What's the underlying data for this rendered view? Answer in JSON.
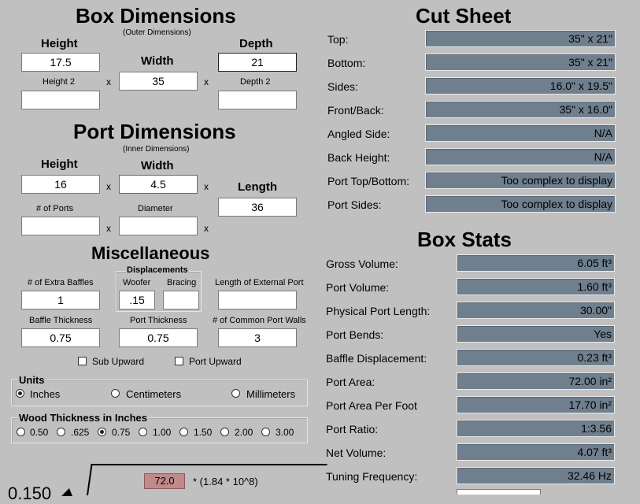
{
  "box_dimensions": {
    "title": "Box Dimensions",
    "subtitle": "(Outer Dimensions)",
    "height_label": "Height",
    "width_label": "Width",
    "depth_label": "Depth",
    "height2_label": "Height 2",
    "depth2_label": "Depth 2",
    "height_value": "17.5",
    "width_value": "35",
    "depth_value": "21",
    "height2_value": "",
    "depth2_value": "",
    "x": "x"
  },
  "port_dimensions": {
    "title": "Port Dimensions",
    "subtitle": "(Inner Dimensions)",
    "height_label": "Height",
    "width_label": "Width",
    "length_label": "Length",
    "ports_label": "# of Ports",
    "diameter_label": "Diameter",
    "height_value": "16",
    "width_value": "4.5",
    "length_value": "36",
    "ports_value": "",
    "diameter_value": "",
    "x": "x"
  },
  "misc": {
    "title": "Miscellaneous",
    "displacements_label": "Displacements",
    "extra_baffles_label": "# of Extra Baffles",
    "woofer_label": "Woofer",
    "bracing_label": "Bracing",
    "ext_port_label": "Length of External Port",
    "baffle_thickness_label": "Baffle Thickness",
    "port_thickness_label": "Port Thickness",
    "common_walls_label": "# of Common Port Walls",
    "extra_baffles_value": "1",
    "woofer_value": ".15",
    "bracing_value": "",
    "ext_port_value": "",
    "baffle_thickness_value": "0.75",
    "port_thickness_value": "0.75",
    "common_walls_value": "3",
    "sub_upward_label": "Sub Upward",
    "port_upward_label": "Port Upward"
  },
  "units": {
    "title": "Units",
    "options": [
      "Inches",
      "Centimeters",
      "Millimeters"
    ],
    "selected": "Inches"
  },
  "wood": {
    "title": "Wood Thickness in Inches",
    "options": [
      "0.50",
      ".625",
      "0.75",
      "1.00",
      "1.50",
      "2.00",
      "3.00"
    ],
    "selected": "0.75"
  },
  "bottom": {
    "value_box": "72.0",
    "formula": "* (1.84 * 10^8)",
    "partial_label": "0.150"
  },
  "cut_sheet": {
    "title": "Cut Sheet",
    "rows": [
      {
        "label": "Top:",
        "value": "35\" x 21\""
      },
      {
        "label": "Bottom:",
        "value": "35\" x 21\""
      },
      {
        "label": "Sides:",
        "value": "16.0\" x 19.5\""
      },
      {
        "label": "Front/Back:",
        "value": "35\" x 16.0\""
      },
      {
        "label": "Angled Side:",
        "value": "N/A"
      },
      {
        "label": "Back Height:",
        "value": "N/A"
      },
      {
        "label": "Port Top/Bottom:",
        "value": "Too complex to display"
      },
      {
        "label": "Port Sides:",
        "value": "Too complex to display"
      }
    ]
  },
  "box_stats": {
    "title": "Box Stats",
    "rows": [
      {
        "label": "Gross Volume:",
        "value": "6.05 ft³"
      },
      {
        "label": "Port Volume:",
        "value": "1.60 ft³"
      },
      {
        "label": "Physical Port Length:",
        "value": "30.00\""
      },
      {
        "label": "Port Bends:",
        "value": "Yes"
      },
      {
        "label": "Baffle Displacement:",
        "value": "0.23 ft³"
      },
      {
        "label": "Port Area:",
        "value": "72.00 in²"
      },
      {
        "label": "Port Area Per Foot",
        "value": "17.70 in²"
      },
      {
        "label": "Port Ratio:",
        "value": "1:3.56"
      },
      {
        "label": "Net Volume:",
        "value": "4.07 ft³"
      },
      {
        "label": "Tuning Frequency:",
        "value": "32.46 Hz"
      }
    ]
  }
}
